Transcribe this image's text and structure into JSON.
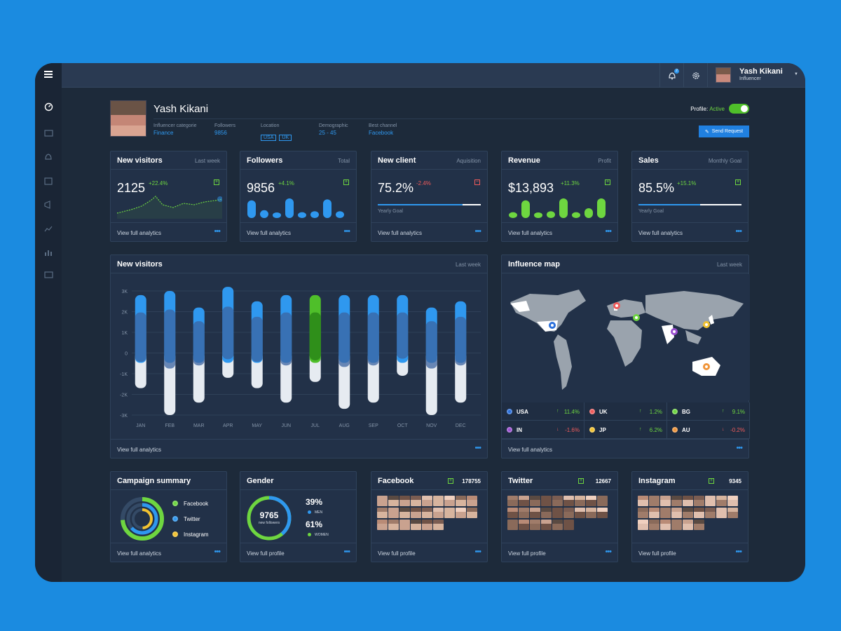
{
  "topbar": {
    "notification_count": "2",
    "user_name": "Yash Kikani",
    "user_role": "Influencer"
  },
  "profile": {
    "name": "Yash Kikani",
    "status_label": "Profile:",
    "status_value": "Active",
    "send_request": "Send Request",
    "fields": [
      {
        "label": "Influencer categorie",
        "value": "Finance"
      },
      {
        "label": "Followers",
        "value": "9856"
      },
      {
        "label": "Location",
        "tags": [
          "USA",
          "UK"
        ]
      },
      {
        "label": "Demographic",
        "value": "25 - 45"
      },
      {
        "label": "Best channel",
        "value": "Facebook"
      }
    ]
  },
  "stats": [
    {
      "title": "New visitors",
      "sub": "Last week",
      "value": "2125",
      "change": "+22.4%",
      "trend": "up",
      "footer": "View full analytics"
    },
    {
      "title": "Followers",
      "sub": "Total",
      "value": "9856",
      "change": "+4.1%",
      "trend": "up",
      "footer": "View full analytics"
    },
    {
      "title": "New client",
      "sub": "Aquisition",
      "value": "75.2%",
      "change": "-2.4%",
      "trend": "down",
      "goal_label": "Yearly Goal",
      "goal_progress": 0.82,
      "footer": "View full analytics"
    },
    {
      "title": "Revenue",
      "sub": "Profit",
      "value": "$13,893",
      "change": "+11.3%",
      "trend": "up",
      "footer": "View full analytics"
    },
    {
      "title": "Sales",
      "sub": "Monthly Goal",
      "value": "85.5%",
      "change": "+15.1%",
      "trend": "up",
      "goal_label": "Yearly Goal",
      "goal_progress": 0.6,
      "footer": "View full analytics"
    }
  ],
  "visitors_chart": {
    "title": "New visitors",
    "sub": "Last week",
    "footer": "View full analytics",
    "highlight_color": "#4fbf2a",
    "chart_data": {
      "type": "bar",
      "categories": [
        "JAN",
        "FEB",
        "MAR",
        "APR",
        "MAY",
        "JUN",
        "JUL",
        "AUG",
        "SEP",
        "OCT",
        "NOV",
        "DEC"
      ],
      "y_ticks": [
        "3K",
        "2K",
        "1K",
        "0",
        "-1K",
        "-2K",
        "-3K"
      ],
      "ylim": [
        -3000,
        3000
      ],
      "highlight": "JUL",
      "series": [
        {
          "values": [
            2800,
            3000,
            2200,
            3200,
            2500,
            2800,
            2800,
            2800,
            2800,
            2800,
            2200,
            2500
          ]
        },
        {
          "values": [
            -1700,
            -3000,
            -2400,
            -1200,
            -1700,
            -2400,
            -1400,
            -2700,
            -2400,
            -1100,
            -3000,
            -2400
          ]
        }
      ]
    }
  },
  "map": {
    "title": "Influence map",
    "sub": "Last week",
    "footer": "View full analytics",
    "countries": [
      {
        "code": "USA",
        "change": "11.4%",
        "trend": "up",
        "color": "#2a6fdb"
      },
      {
        "code": "UK",
        "change": "1.2%",
        "trend": "up",
        "color": "#ef5b5b"
      },
      {
        "code": "BG",
        "change": "9.1%",
        "trend": "up",
        "color": "#6ed640"
      },
      {
        "code": "IN",
        "change": "-1.6%",
        "trend": "down",
        "color": "#9b4fd1"
      },
      {
        "code": "JP",
        "change": "6.2%",
        "trend": "up",
        "color": "#f2c230"
      },
      {
        "code": "AU",
        "change": "-0.2%",
        "trend": "down",
        "color": "#f0953a"
      }
    ]
  },
  "campaign": {
    "title": "Campaign summary",
    "footer": "View full analytics",
    "legend": [
      {
        "name": "Facebook",
        "color": "#6ed640"
      },
      {
        "name": "Twitter",
        "color": "#2f98ef"
      },
      {
        "name": "Instagram",
        "color": "#f2c230"
      }
    ]
  },
  "gender": {
    "title": "Gender",
    "total": "9765",
    "total_label": "new followers",
    "men_pct": "39%",
    "men_label": "MEN",
    "women_pct": "61%",
    "women_label": "WOMEN",
    "footer": "View full profile"
  },
  "socials": [
    {
      "title": "Facebook",
      "count": "178755",
      "footer": "View full profile"
    },
    {
      "title": "Twitter",
      "count": "12667",
      "footer": "View full profile"
    },
    {
      "title": "Instagram",
      "count": "9345",
      "footer": "View full profile"
    }
  ]
}
